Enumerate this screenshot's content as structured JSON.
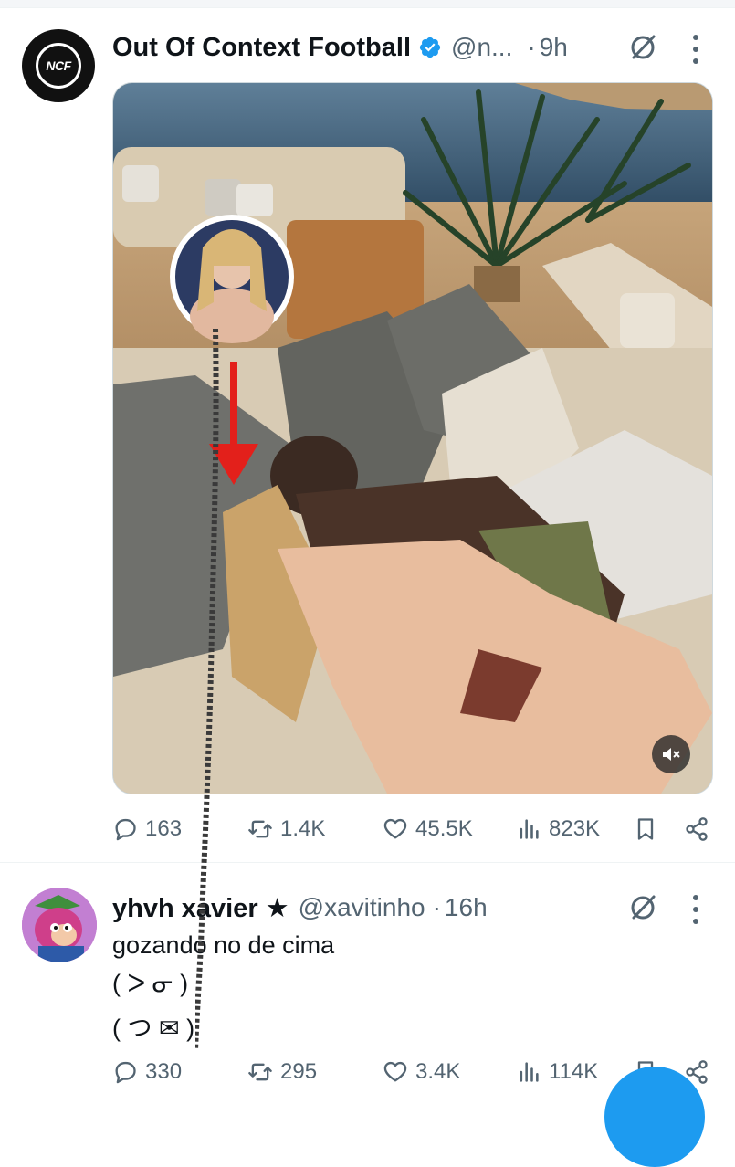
{
  "tweet": {
    "author_name": "Out Of Context Football",
    "author_handle": "@n...",
    "separator": "·",
    "time": "9h",
    "avatar_text": "NCF",
    "stats": {
      "replies": "163",
      "reposts": "1.4K",
      "likes": "45.5K",
      "views": "823K"
    }
  },
  "reply": {
    "author_name": "yhvh xavier ★",
    "author_handle": "@xavitinho",
    "separator": "·",
    "time": "16h",
    "lines": [
      "gozando no de cima",
      "( ᐳ ᓂ )",
      "(  つ ✉  )"
    ],
    "stats": {
      "replies": "330",
      "reposts": "295",
      "likes": "3.4K",
      "views": "114K"
    }
  },
  "colors": {
    "brand_blue": "#1d9bf0",
    "muted_text": "#536471",
    "annotation_red": "#e3201b"
  },
  "icons": [
    "ncf-logo-icon",
    "verified-badge-icon",
    "grok-icon",
    "more-icon",
    "mute-icon",
    "reply-icon",
    "repost-icon",
    "like-icon",
    "views-icon",
    "bookmark-icon",
    "share-icon"
  ]
}
